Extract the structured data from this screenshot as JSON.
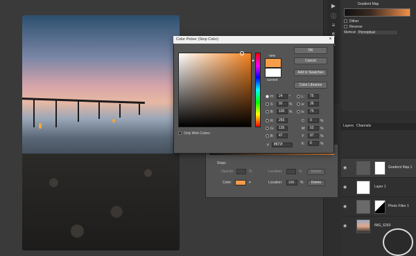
{
  "dialog": {
    "title": "Color Picker (Stop Color)",
    "buttons": {
      "ok": "OK",
      "cancel": "Cancel",
      "add_to_swatches": "Add to Swatches",
      "color_libraries": "Color Libraries"
    },
    "swatch_labels": {
      "new": "new",
      "current": "current"
    },
    "only_web_colors": "Only Web Colors",
    "fields": {
      "H": {
        "label": "H:",
        "value": "24",
        "unit": "°"
      },
      "S": {
        "label": "S:",
        "value": "92",
        "unit": "%"
      },
      "B": {
        "label": "B:",
        "value": "100",
        "unit": "%"
      },
      "R": {
        "label": "R:",
        "value": "255"
      },
      "G": {
        "label": "G:",
        "value": "135"
      },
      "Bl": {
        "label": "B:",
        "value": "47"
      },
      "L": {
        "label": "L:",
        "value": "75"
      },
      "a": {
        "label": "a:",
        "value": "36"
      },
      "b": {
        "label": "b:",
        "value": "75"
      },
      "C": {
        "label": "C:",
        "value": "0",
        "unit": "%"
      },
      "M": {
        "label": "M:",
        "value": "52",
        "unit": "%"
      },
      "Y": {
        "label": "Y:",
        "value": "87",
        "unit": "%"
      },
      "K": {
        "label": "K:",
        "value": "0",
        "unit": "%"
      },
      "hex": {
        "label": "#",
        "value": "ff872f"
      }
    },
    "new_color": "#f59d4a",
    "current_color": "#ffffff"
  },
  "gradient_editor": {
    "stops_label": "Stops",
    "opacity_label": "Opacity:",
    "location_label": "Location:",
    "delete_label": "Delete",
    "color_label": "Color:",
    "location_value": "100",
    "percent": "%",
    "stop_color": "#f59d4a"
  },
  "properties": {
    "title": "Gradient Map",
    "dither": "Dither",
    "reverse": "Reverse",
    "method_label": "Method:",
    "method_value": "Perceptual"
  },
  "layers_panel": {
    "tabs": [
      "Layers",
      "Channels"
    ],
    "layers": [
      {
        "name": "Gradient Map 1"
      },
      {
        "name": "Layer 1"
      },
      {
        "name": "Photo Filter 1"
      },
      {
        "name": "IMG_6260"
      }
    ]
  }
}
